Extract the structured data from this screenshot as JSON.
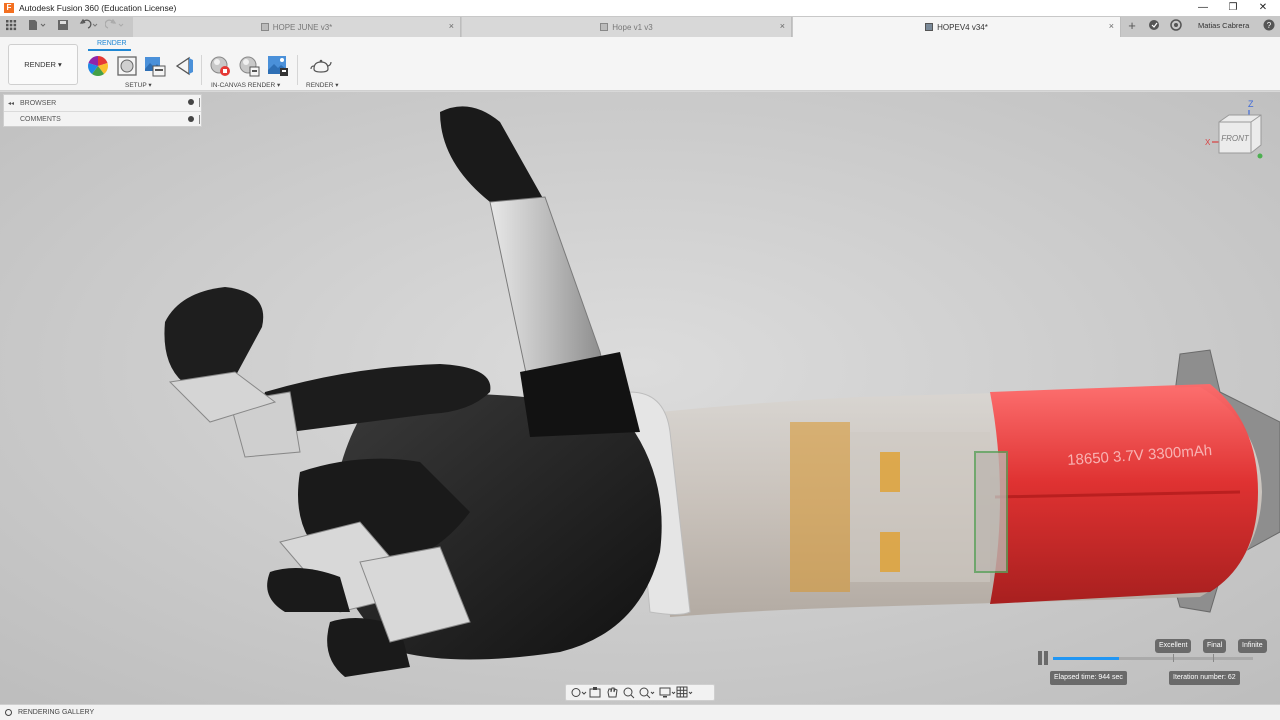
{
  "window": {
    "title": "Autodesk Fusion 360 (Education License)",
    "app_logo": "F",
    "controls": {
      "minimize": "—",
      "maximize": "❐",
      "close": "✕"
    }
  },
  "tabs": [
    {
      "label": "HOPE JUNE v3*",
      "active": false
    },
    {
      "label": "Hope v1 v3",
      "active": false
    },
    {
      "label": "HOPEV4 v34*",
      "active": true
    }
  ],
  "tab_close_glyph": "×",
  "user": {
    "name": "Matias Cabrera"
  },
  "toolbar": {
    "workspace_label": "RENDER ▾",
    "active_tab": "RENDER",
    "groups": {
      "setup": "SETUP ▾",
      "in_canvas_render": "IN-CANVAS RENDER ▾",
      "render": "RENDER ▾"
    }
  },
  "browser": {
    "rows": [
      {
        "label": "BROWSER"
      },
      {
        "label": "COMMENTS"
      }
    ]
  },
  "viewcube": {
    "face": "FRONT",
    "axis_z": "Z",
    "axis_x": "X"
  },
  "scene": {
    "battery_label": "18650 3.7V 3300mAh"
  },
  "render_progress": {
    "quality_levels": [
      "Excellent",
      "Final",
      "Infinite"
    ],
    "progress_fraction": 0.33,
    "elapsed": "Elapsed time: 944 sec",
    "iteration": "Iteration number: 62"
  },
  "bottom_bar": {
    "label": "RENDERING GALLERY"
  },
  "colors": {
    "accent": "#1f87d4",
    "progress": "#2196f3",
    "battery_red": "#e02a2a"
  }
}
